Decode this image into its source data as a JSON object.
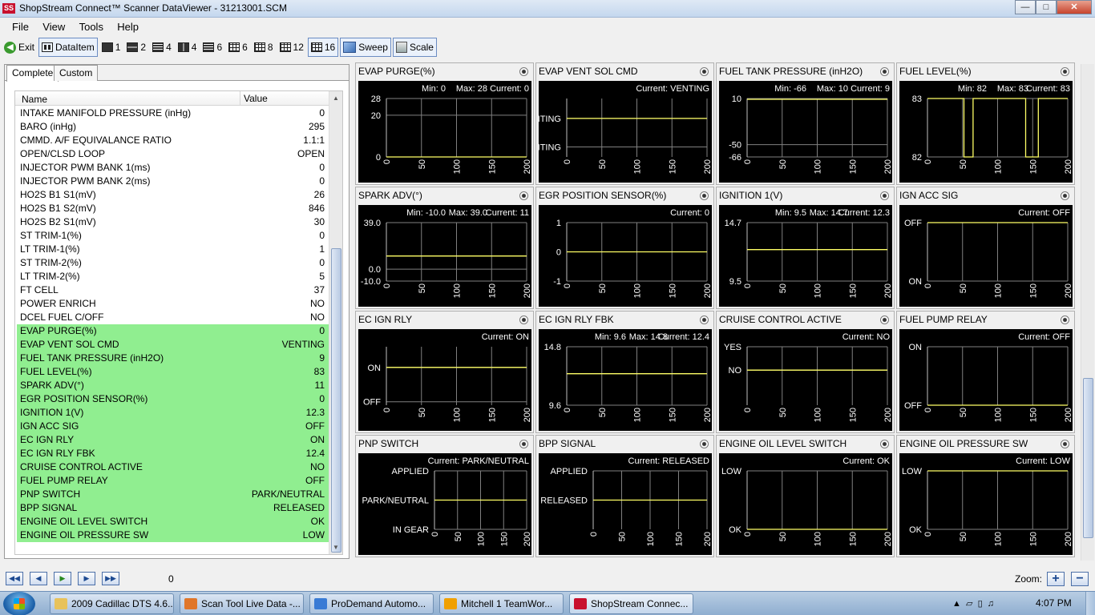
{
  "window": {
    "title": "ShopStream Connect™ Scanner DataViewer - 31213001.SCM",
    "app_icon": "SS"
  },
  "menu": [
    "File",
    "View",
    "Tools",
    "Help"
  ],
  "toolbar": {
    "exit": "Exit",
    "dataitem": "DataItem",
    "layouts": [
      "1",
      "2",
      "4",
      "4",
      "6",
      "6",
      "8",
      "12",
      "16"
    ],
    "sweep": "Sweep",
    "scale": "Scale"
  },
  "left": {
    "tabs": [
      "Complete",
      "Custom"
    ],
    "col_name": "Name",
    "col_value": "Value",
    "rows": [
      {
        "name": "INTAKE MANIFOLD PRESSURE (inHg)",
        "value": "0",
        "hl": false
      },
      {
        "name": "BARO (inHg)",
        "value": "295",
        "hl": false
      },
      {
        "name": "CMMD. A/F EQUIVALANCE RATIO",
        "value": "1.1:1",
        "hl": false
      },
      {
        "name": "OPEN/CLSD LOOP",
        "value": "OPEN",
        "hl": false
      },
      {
        "name": "INJECTOR PWM BANK 1(ms)",
        "value": "0",
        "hl": false
      },
      {
        "name": "INJECTOR PWM BANK 2(ms)",
        "value": "0",
        "hl": false
      },
      {
        "name": "HO2S B1 S1(mV)",
        "value": "26",
        "hl": false
      },
      {
        "name": "HO2S B1 S2(mV)",
        "value": "846",
        "hl": false
      },
      {
        "name": "HO2S B2 S1(mV)",
        "value": "30",
        "hl": false
      },
      {
        "name": "ST TRIM-1(%)",
        "value": "0",
        "hl": false
      },
      {
        "name": "LT TRIM-1(%)",
        "value": "1",
        "hl": false
      },
      {
        "name": "ST TRIM-2(%)",
        "value": "0",
        "hl": false
      },
      {
        "name": "LT TRIM-2(%)",
        "value": "5",
        "hl": false
      },
      {
        "name": "FT CELL",
        "value": "37",
        "hl": false
      },
      {
        "name": "POWER ENRICH",
        "value": "NO",
        "hl": false
      },
      {
        "name": "DCEL FUEL C/OFF",
        "value": "NO",
        "hl": false
      },
      {
        "name": "EVAP PURGE(%)",
        "value": "0",
        "hl": true
      },
      {
        "name": "EVAP VENT SOL CMD",
        "value": "VENTING",
        "hl": true
      },
      {
        "name": "FUEL TANK PRESSURE  (inH2O)",
        "value": "9",
        "hl": true
      },
      {
        "name": "FUEL LEVEL(%)",
        "value": "83",
        "hl": true
      },
      {
        "name": "SPARK ADV(°)",
        "value": "11",
        "hl": true
      },
      {
        "name": "EGR POSITION SENSOR(%)",
        "value": "0",
        "hl": true
      },
      {
        "name": "IGNITION 1(V)",
        "value": "12.3",
        "hl": true
      },
      {
        "name": "IGN ACC SIG",
        "value": "OFF",
        "hl": true
      },
      {
        "name": "EC IGN RLY",
        "value": "ON",
        "hl": true
      },
      {
        "name": "EC IGN RLY FBK",
        "value": "12.4",
        "hl": true
      },
      {
        "name": "CRUISE CONTROL ACTIVE",
        "value": "NO",
        "hl": true
      },
      {
        "name": "FUEL PUMP RELAY",
        "value": "OFF",
        "hl": true
      },
      {
        "name": "PNP SWITCH",
        "value": "PARK/NEUTRAL",
        "hl": true
      },
      {
        "name": "BPP SIGNAL",
        "value": "RELEASED",
        "hl": true
      },
      {
        "name": "ENGINE OIL LEVEL SWITCH",
        "value": "OK",
        "hl": true
      },
      {
        "name": "ENGINE OIL PRESSURE SW",
        "value": "LOW",
        "hl": true
      }
    ]
  },
  "charts": [
    {
      "title": "EVAP PURGE(%)",
      "minmax": [
        "Min: 0",
        "Max: 28",
        "Current: 0"
      ],
      "ylabels": [
        "28",
        "20",
        "0"
      ],
      "ylevels": [
        28,
        20,
        0
      ],
      "range": [
        0,
        28
      ],
      "line": [
        0,
        0,
        200,
        0
      ]
    },
    {
      "title": "EVAP VENT SOL CMD",
      "minmax": [
        "Current: VENTING"
      ],
      "ylabels": [
        "VENTING",
        "NOT VENTING"
      ],
      "ylevels": [
        1,
        0
      ],
      "range": [
        -0.35,
        1.7
      ],
      "line": [
        0,
        1,
        200,
        1
      ]
    },
    {
      "title": "FUEL TANK PRESSURE  (inH2O)",
      "minmax": [
        "Min: -66",
        "Max: 10",
        "Current: 9"
      ],
      "ylabels": [
        "10",
        "-50",
        "-66"
      ],
      "ylevels": [
        10,
        -50,
        -66
      ],
      "range": [
        -66,
        10
      ],
      "line": [
        0,
        9,
        200,
        9
      ]
    },
    {
      "title": "FUEL LEVEL(%)",
      "minmax": [
        "Min: 82",
        "Max: 83",
        "Current: 83"
      ],
      "ylabels": [
        "83",
        "82"
      ],
      "ylevels": [
        83,
        82
      ],
      "range": [
        82,
        83
      ],
      "step": [
        [
          0,
          83
        ],
        [
          52,
          83
        ],
        [
          52,
          82
        ],
        [
          65,
          82
        ],
        [
          65,
          83
        ],
        [
          140,
          83
        ],
        [
          140,
          82
        ],
        [
          158,
          82
        ],
        [
          158,
          83
        ],
        [
          200,
          83
        ]
      ]
    },
    {
      "title": "SPARK ADV(°)",
      "minmax": [
        "Min: -10.0",
        "Max: 39.0",
        "Current: 11"
      ],
      "ylabels": [
        "39.0",
        "0.0",
        "-10.0"
      ],
      "ylevels": [
        39,
        0,
        -10
      ],
      "range": [
        -10,
        39
      ],
      "line": [
        0,
        11,
        200,
        11
      ]
    },
    {
      "title": "EGR POSITION SENSOR(%)",
      "minmax": [
        "Current: 0"
      ],
      "ylabels": [
        "1",
        "0",
        "-1"
      ],
      "ylevels": [
        1,
        0,
        -1
      ],
      "range": [
        -1,
        1
      ],
      "line": [
        0,
        0,
        200,
        0
      ]
    },
    {
      "title": "IGNITION 1(V)",
      "minmax": [
        "Min: 9.5",
        "Max: 14.7",
        "Current: 12.3"
      ],
      "ylabels": [
        "14.7",
        "9.5"
      ],
      "ylevels": [
        14.7,
        9.5
      ],
      "range": [
        9.5,
        14.7
      ],
      "line": [
        0,
        12.3,
        200,
        12.3
      ]
    },
    {
      "title": "IGN ACC SIG",
      "minmax": [
        "Current: OFF"
      ],
      "ylabels": [
        "OFF",
        "ON"
      ],
      "ylevels": [
        1,
        0
      ],
      "range": [
        0,
        1
      ],
      "line": [
        0,
        1,
        200,
        1
      ]
    },
    {
      "title": "EC IGN RLY",
      "minmax": [
        "Current: ON"
      ],
      "ylabels": [
        "ON",
        "OFF"
      ],
      "ylevels": [
        1,
        0
      ],
      "range": [
        -0.1,
        1.6
      ],
      "line": [
        0,
        1,
        200,
        1
      ]
    },
    {
      "title": "EC IGN RLY FBK",
      "minmax": [
        "Min: 9.6",
        "Max: 14.8",
        "Current: 12.4"
      ],
      "ylabels": [
        "14.8",
        "9.6"
      ],
      "ylevels": [
        14.8,
        9.6
      ],
      "range": [
        9.6,
        14.8
      ],
      "line": [
        0,
        12.4,
        200,
        12.4
      ]
    },
    {
      "title": "CRUISE CONTROL ACTIVE",
      "minmax": [
        "Current: NO"
      ],
      "ylabels": [
        "YES",
        "NO"
      ],
      "ylevels": [
        1,
        0
      ],
      "range": [
        -1.5,
        1
      ],
      "line": [
        0,
        0,
        200,
        0
      ]
    },
    {
      "title": "FUEL PUMP RELAY",
      "minmax": [
        "Current: OFF"
      ],
      "ylabels": [
        "ON",
        "OFF"
      ],
      "ylevels": [
        1,
        0
      ],
      "range": [
        0,
        1
      ],
      "line": [
        0,
        0,
        200,
        0
      ]
    },
    {
      "title": "PNP SWITCH",
      "minmax": [
        "Current: PARK/NEUTRAL"
      ],
      "ylabels": [
        "APPLIED",
        "PARK/NEUTRAL",
        "IN GEAR"
      ],
      "ylevels": [
        2,
        1,
        0
      ],
      "range": [
        0,
        2
      ],
      "line": [
        0,
        1,
        200,
        1
      ],
      "plotleft": 95
    },
    {
      "title": "BPP SIGNAL",
      "minmax": [
        "Current: RELEASED"
      ],
      "ylabels": [
        "APPLIED",
        "RELEASED"
      ],
      "ylevels": [
        1,
        0
      ],
      "range": [
        -1,
        1
      ],
      "line": [
        0,
        0,
        200,
        0
      ],
      "plotleft": 68
    },
    {
      "title": "ENGINE OIL LEVEL SWITCH",
      "minmax": [
        "Current: OK"
      ],
      "ylabels": [
        "LOW",
        "OK"
      ],
      "ylevels": [
        1,
        0
      ],
      "range": [
        0,
        1
      ],
      "line": [
        0,
        0,
        200,
        0
      ]
    },
    {
      "title": "ENGINE OIL PRESSURE SW",
      "minmax": [
        "Current: LOW"
      ],
      "ylabels": [
        "LOW",
        "OK"
      ],
      "ylevels": [
        1,
        0
      ],
      "range": [
        0,
        1
      ],
      "line": [
        0,
        1,
        200,
        1
      ]
    }
  ],
  "xticks": [
    "0",
    "50",
    "100",
    "150",
    "200"
  ],
  "trace_color": "#ffff66",
  "grid_color": "#808080",
  "bottom": {
    "position": "0",
    "zoom": "Zoom:"
  },
  "taskbar": {
    "items": [
      {
        "label": "2009 Cadillac DTS 4.6...",
        "color": "#e8c25a"
      },
      {
        "label": "Scan Tool Live Data -...",
        "color": "#e0762a"
      },
      {
        "label": "ProDemand Automo...",
        "color": "#3a7bd5"
      },
      {
        "label": "Mitchell 1 TeamWor...",
        "color": "#f0a000"
      },
      {
        "label": "ShopStream Connec...",
        "color": "#c8102e"
      }
    ],
    "clock": "4:07 PM"
  }
}
